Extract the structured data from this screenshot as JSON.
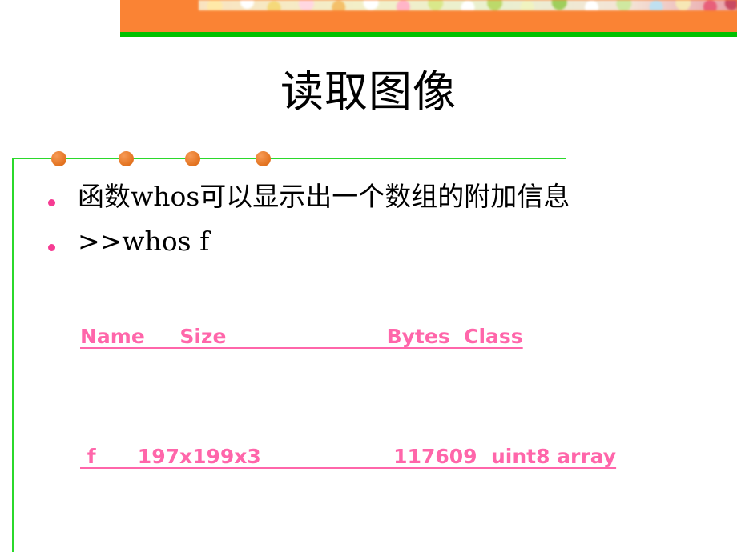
{
  "slide": {
    "title": "读取图像",
    "banner": {
      "orange_color": "#FA8334",
      "green_color": "#00C000",
      "photo_strip_alt": "floral-confetti-photo-strip"
    },
    "decor": {
      "rule_color": "#2BD92B",
      "dot_color": "#E2721F",
      "dot_count": 4
    },
    "bullets": [
      {
        "marker_color": "#F63C93",
        "text": "函数whos可以显示出一个数组的附加信息"
      },
      {
        "marker_color": "#F63C93",
        "text": ">>whos  f"
      }
    ],
    "whos_output": {
      "color": "#FF66AA",
      "header": "Name     Size                       Bytes  Class",
      "rows": [
        " f      197x199x3                   117609  uint8 array"
      ],
      "columns": [
        "Name",
        "Size",
        "Bytes",
        "Class"
      ],
      "cells": [
        {
          "name": "f",
          "size": "197x199x3",
          "bytes": "117609",
          "class": "uint8 array"
        }
      ]
    }
  }
}
